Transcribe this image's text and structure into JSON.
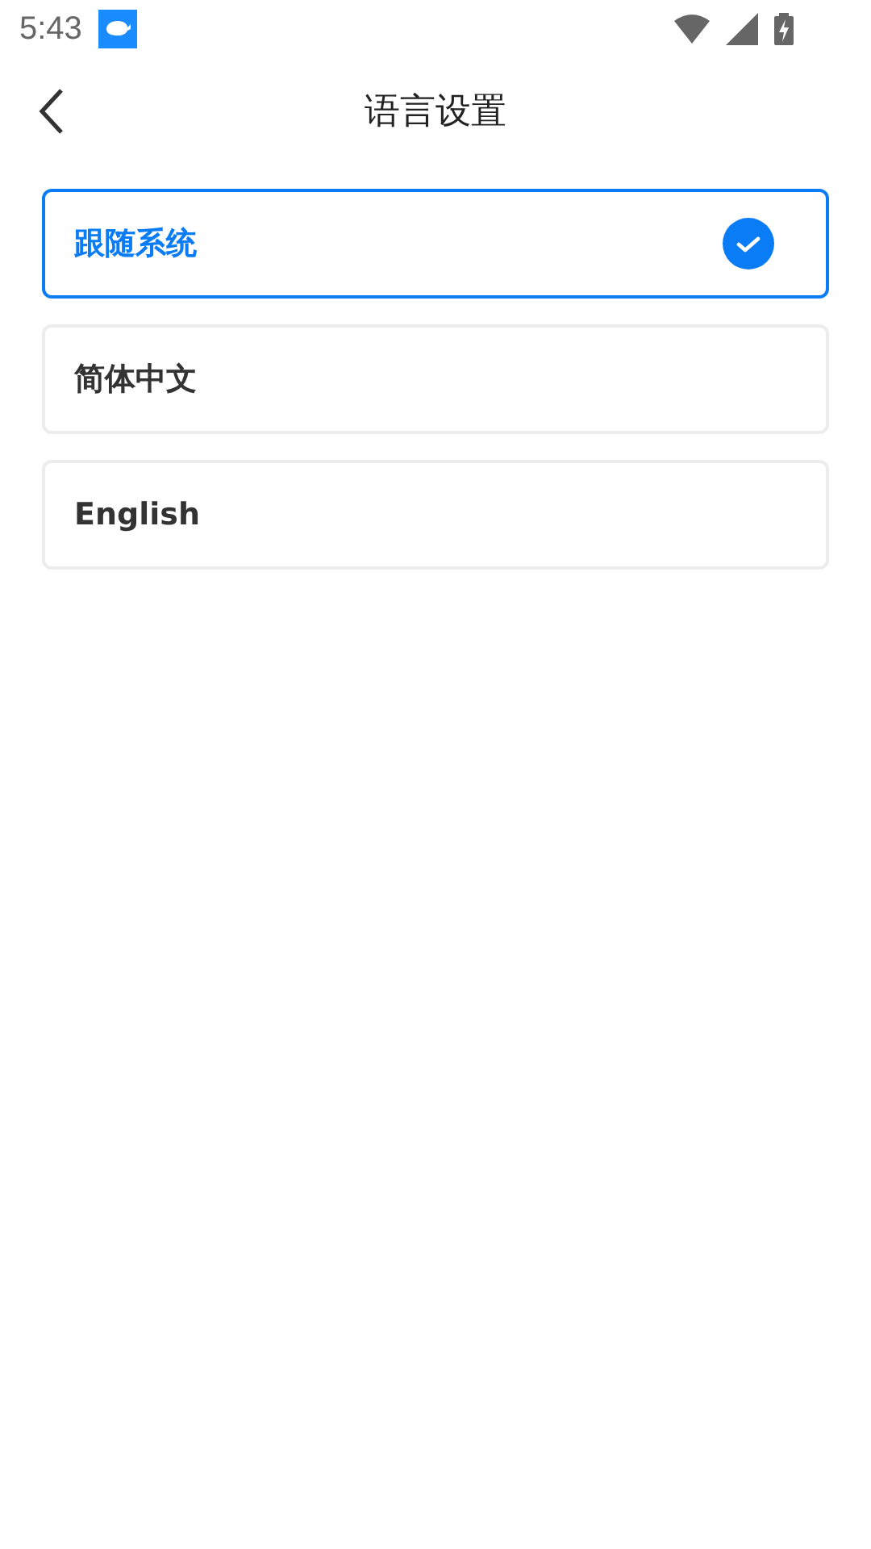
{
  "status_bar": {
    "time": "5:43"
  },
  "header": {
    "title": "语言设置"
  },
  "languages": [
    {
      "label": "跟随系统",
      "selected": true
    },
    {
      "label": "简体中文",
      "selected": false
    },
    {
      "label": "English",
      "selected": false
    }
  ]
}
